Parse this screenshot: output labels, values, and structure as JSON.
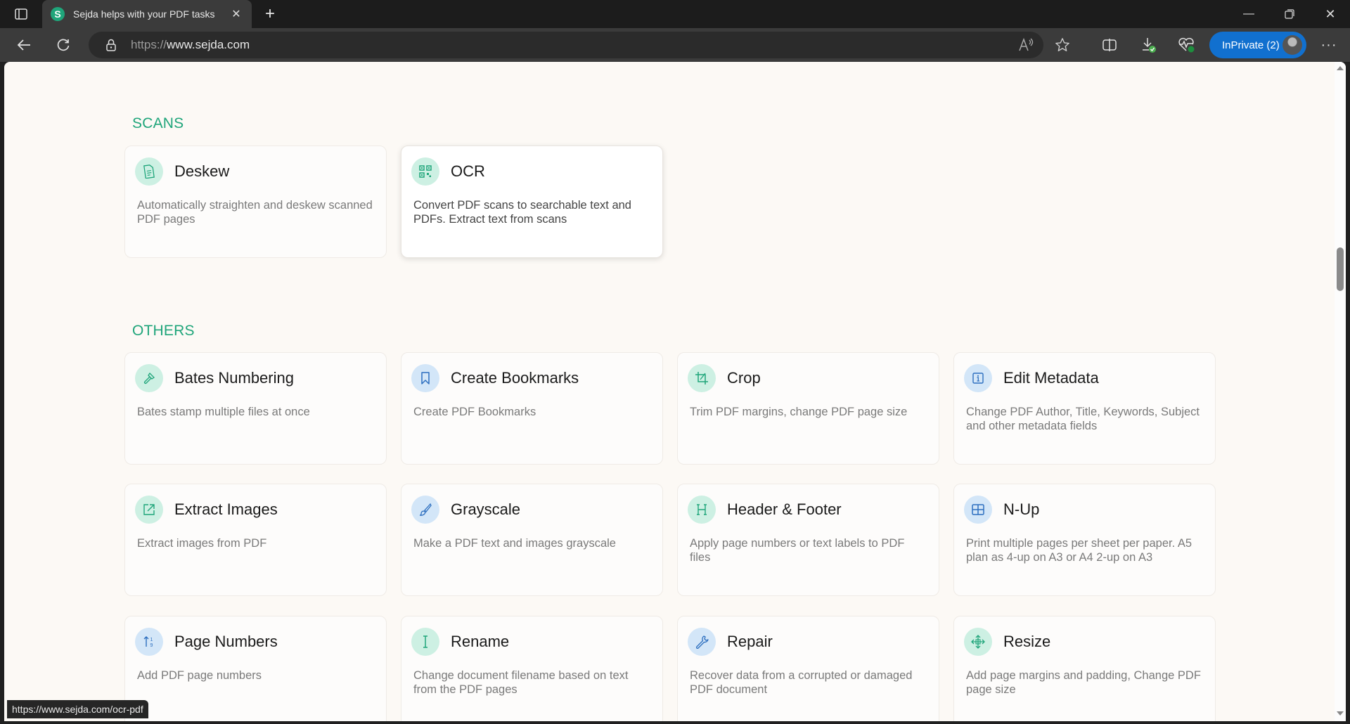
{
  "browser": {
    "tab_title": "Sejda helps with your PDF tasks",
    "tab_favicon_letter": "S",
    "url_protocol": "https://",
    "url_host": "www.sejda.com",
    "inprivate_label": "InPrivate (2)",
    "status_url": "https://www.sejda.com/ocr-pdf",
    "icons": {
      "tab_actions": "tab-actions-icon",
      "close_tab": "close-icon",
      "new_tab": "plus-icon",
      "back": "arrow-left-icon",
      "refresh": "refresh-icon",
      "lock": "lock-icon",
      "read_aloud": "read-aloud-icon",
      "favorite": "star-icon",
      "split_screen": "split-screen-icon",
      "downloads": "download-icon",
      "browser_essentials": "heartbeat-icon",
      "more": "more-icon",
      "minimize": "minimize-icon",
      "maximize": "restore-icon",
      "close_window": "close-icon"
    }
  },
  "accent_color": "#1fa57a",
  "sections": [
    {
      "title": "SCANS",
      "tools": [
        {
          "name": "Deskew",
          "description": "Automatically straighten and deskew scanned PDF pages",
          "icon": "document-icon",
          "icon_color": "green"
        },
        {
          "name": "OCR",
          "description": "Convert PDF scans to searchable text and PDFs. Extract text from scans",
          "icon": "qr-scan-icon",
          "icon_color": "green",
          "hovered": true
        }
      ]
    },
    {
      "title": "OTHERS",
      "tools": [
        {
          "name": "Bates Numbering",
          "description": "Bates stamp multiple files at once",
          "icon": "stamp-icon",
          "icon_color": "green"
        },
        {
          "name": "Create Bookmarks",
          "description": "Create PDF Bookmarks",
          "icon": "bookmark-icon",
          "icon_color": "blue"
        },
        {
          "name": "Crop",
          "description": "Trim PDF margins, change PDF page size",
          "icon": "crop-icon",
          "icon_color": "green"
        },
        {
          "name": "Edit Metadata",
          "description": "Change PDF Author, Title, Keywords, Subject and other metadata fields",
          "icon": "info-icon",
          "icon_color": "blue"
        },
        {
          "name": "Extract Images",
          "description": "Extract images from PDF",
          "icon": "external-link-icon",
          "icon_color": "green"
        },
        {
          "name": "Grayscale",
          "description": "Make a PDF text and images grayscale",
          "icon": "brush-icon",
          "icon_color": "blue"
        },
        {
          "name": "Header & Footer",
          "description": "Apply page numbers or text labels to PDF files",
          "icon": "header-icon",
          "icon_color": "green"
        },
        {
          "name": "N-Up",
          "description": "Print multiple pages per sheet per paper. A5 plan as 4-up on A3 or A4 2-up on A3",
          "icon": "grid-icon",
          "icon_color": "blue"
        },
        {
          "name": "Page Numbers",
          "description": "Add PDF page numbers",
          "icon": "sort-numeric-icon",
          "icon_color": "blue"
        },
        {
          "name": "Rename",
          "description": "Change document filename based on text from the PDF pages",
          "icon": "text-cursor-icon",
          "icon_color": "green"
        },
        {
          "name": "Repair",
          "description": "Recover data from a corrupted or damaged PDF document",
          "icon": "wrench-icon",
          "icon_color": "blue"
        },
        {
          "name": "Resize",
          "description": "Add page margins and padding, Change PDF page size",
          "icon": "move-arrows-icon",
          "icon_color": "green"
        }
      ]
    }
  ]
}
